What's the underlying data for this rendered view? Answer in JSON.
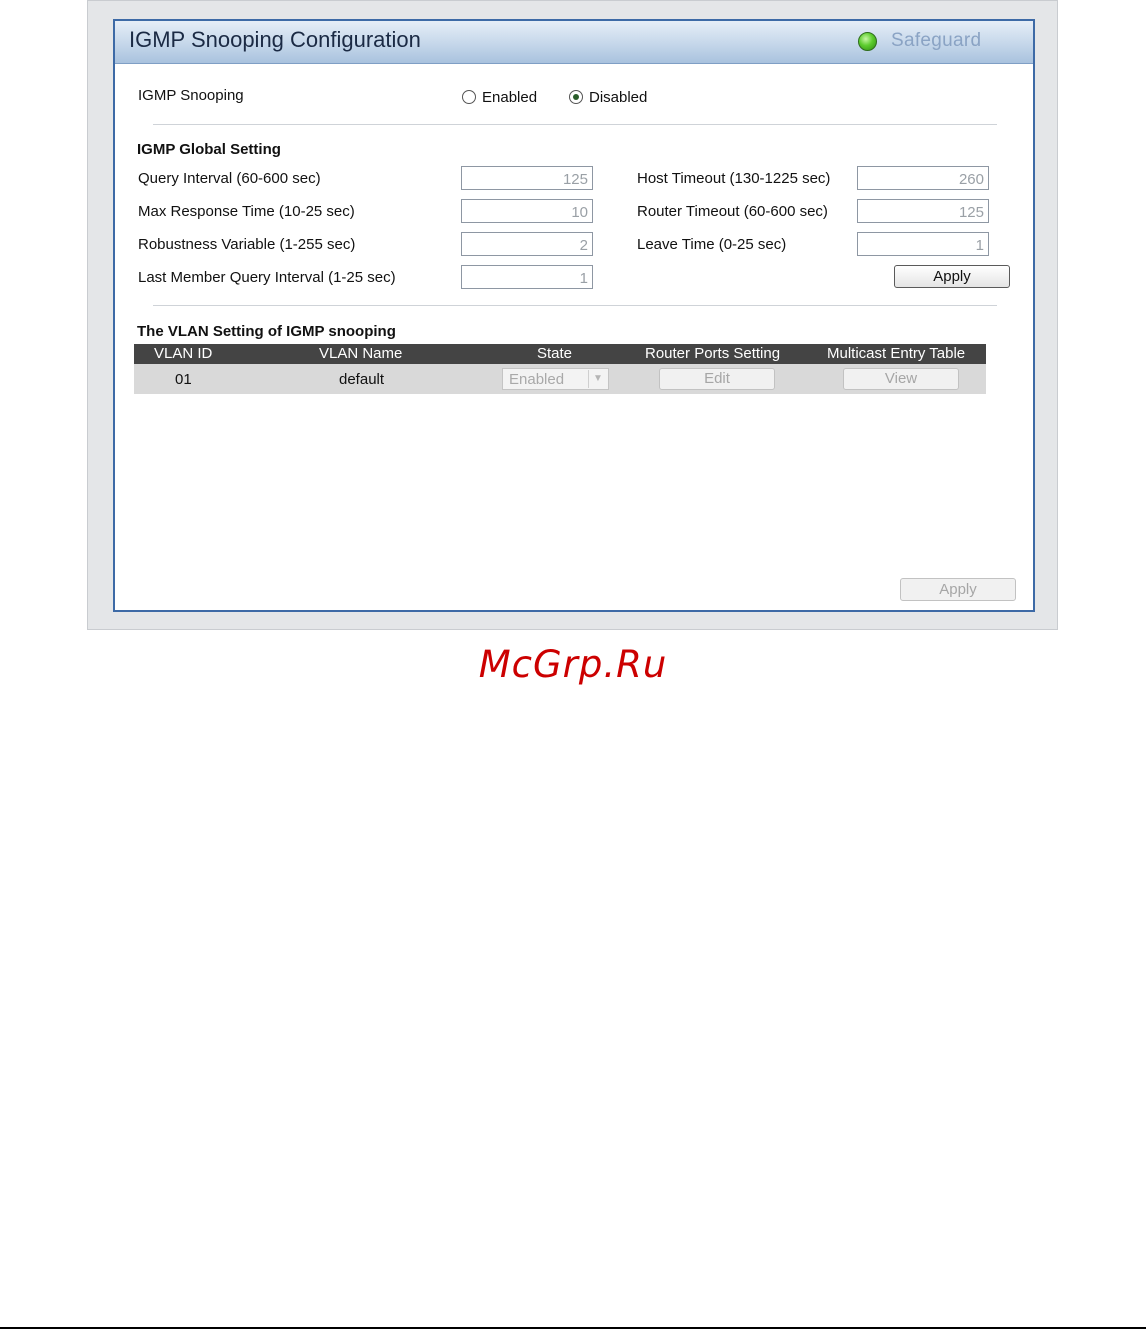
{
  "header": {
    "title": "IGMP Snooping Configuration",
    "safeguard_label": "Safeguard"
  },
  "igmp_snooping": {
    "label": "IGMP Snooping",
    "options": {
      "enabled": "Enabled",
      "disabled": "Disabled"
    },
    "selected": "Disabled"
  },
  "global_setting": {
    "heading": "IGMP Global Setting",
    "query_interval": {
      "label": "Query Interval (60-600 sec)",
      "value": "125"
    },
    "max_response_time": {
      "label": "Max Response Time (10-25 sec)",
      "value": "10"
    },
    "robustness_variable": {
      "label": "Robustness Variable (1-255 sec)",
      "value": "2"
    },
    "last_member_query_interval": {
      "label": "Last Member Query Interval (1-25 sec)",
      "value": "1"
    },
    "host_timeout": {
      "label": "Host Timeout (130-1225 sec)",
      "value": "260"
    },
    "router_timeout": {
      "label": "Router Timeout (60-600 sec)",
      "value": "125"
    },
    "leave_time": {
      "label": "Leave Time (0-25 sec)",
      "value": "1"
    },
    "apply_label": "Apply"
  },
  "vlan_setting": {
    "heading": "The VLAN Setting of IGMP snooping",
    "columns": [
      "VLAN ID",
      "VLAN Name",
      "State",
      "Router Ports Setting",
      "Multicast Entry Table"
    ],
    "rows": [
      {
        "vlan_id": "01",
        "vlan_name": "default",
        "state": "Enabled",
        "router_ports": "Edit",
        "multicast": "View"
      }
    ]
  },
  "bottom_apply_label": "Apply",
  "watermark": "McGrp.Ru"
}
